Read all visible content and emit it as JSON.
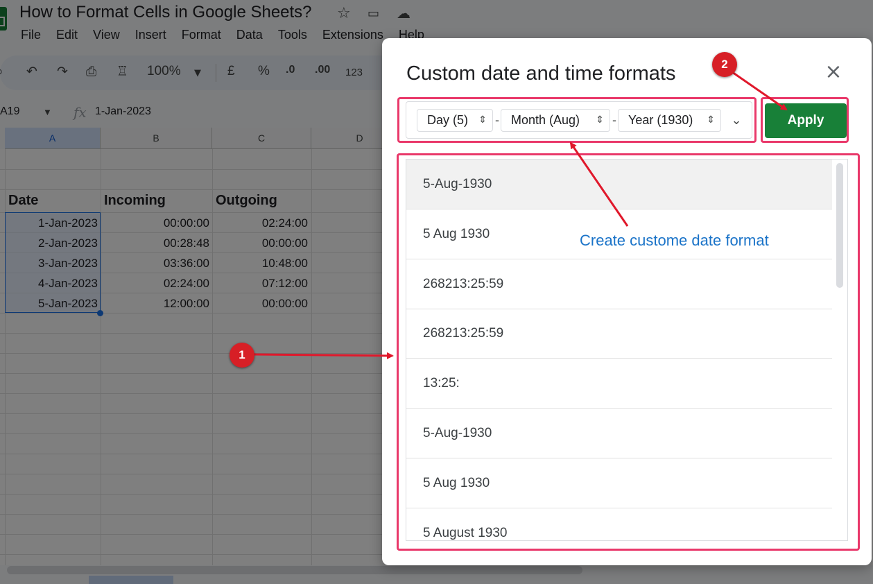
{
  "app": {
    "doc_title": "How to Format Cells in Google Sheets?",
    "menu": [
      "File",
      "Edit",
      "View",
      "Insert",
      "Format",
      "Data",
      "Tools",
      "Extensions",
      "Help"
    ],
    "toolbar": {
      "zoom": "100%",
      "currency": "£",
      "percent": "%",
      "dec_decrease": ".0",
      "dec_increase": ".00",
      "more_formats": "123"
    },
    "name_box": "A19",
    "fx": "fx",
    "formula": "1-Jan-2023",
    "columns": [
      "A",
      "B",
      "C",
      "D"
    ],
    "table": {
      "headers": [
        "Date",
        "Incoming",
        "Outgoing"
      ],
      "rows": [
        [
          "1-Jan-2023",
          "00:00:00",
          "02:24:00"
        ],
        [
          "2-Jan-2023",
          "00:28:48",
          "00:00:00"
        ],
        [
          "3-Jan-2023",
          "03:36:00",
          "10:48:00"
        ],
        [
          "4-Jan-2023",
          "02:24:00",
          "07:12:00"
        ],
        [
          "5-Jan-2023",
          "12:00:00",
          "00:00:00"
        ]
      ]
    }
  },
  "dialog": {
    "title": "Custom date and time formats",
    "close": "×",
    "chips": [
      "Day (5)",
      "Month (Aug)",
      "Year (1930)"
    ],
    "separator": "-",
    "apply": "Apply",
    "formats": [
      "5-Aug-1930",
      "5 Aug 1930",
      "268213:25:59",
      "268213:25:59",
      "13:25:",
      "5-Aug-1930",
      "5 Aug 1930",
      "5 August 1930"
    ]
  },
  "annotations": {
    "badge_1": "1",
    "badge_2": "2",
    "note": "Create custome date format",
    "highlight_color": "#e9386a",
    "arrow_color": "#e0182b"
  },
  "colors": {
    "apply_green": "#188038",
    "link_blue": "#1a73c8",
    "selection_blue": "#1a73e8"
  }
}
